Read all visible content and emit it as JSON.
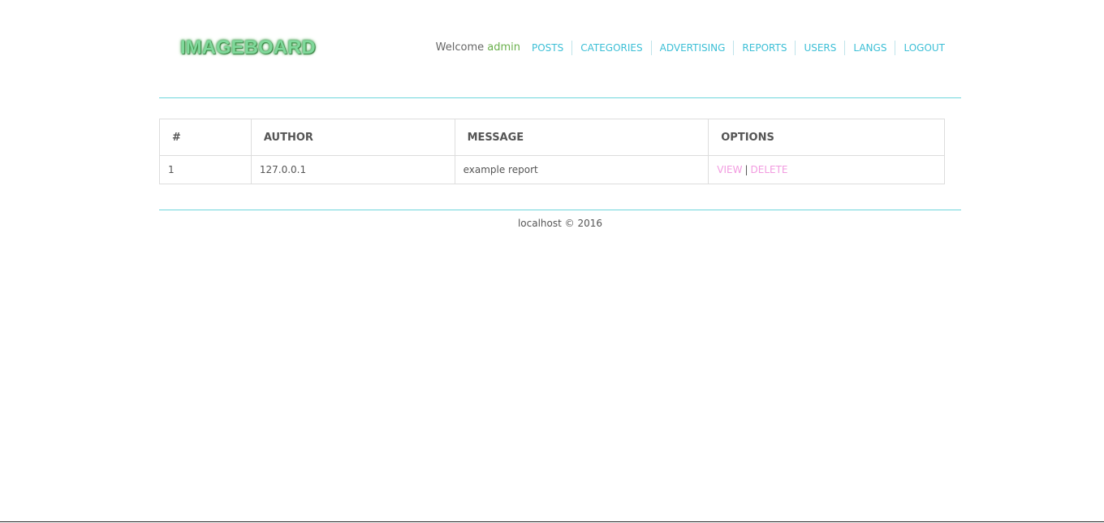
{
  "header": {
    "logo_text": "IMAGEBOARD",
    "welcome_prefix": "Welcome",
    "username": "admin",
    "nav": [
      {
        "label": "POSTS"
      },
      {
        "label": "CATEGORIES"
      },
      {
        "label": "ADVERTISING"
      },
      {
        "label": "REPORTS"
      },
      {
        "label": "USERS"
      },
      {
        "label": "LANGS"
      },
      {
        "label": "LOGOUT"
      }
    ]
  },
  "table": {
    "columns": [
      "#",
      "AUTHOR",
      "MESSAGE",
      "OPTIONS"
    ],
    "rows": [
      {
        "num": "1",
        "author": "127.0.0.1",
        "message": "example report",
        "view_label": "VIEW",
        "separator": "|",
        "delete_label": "DELETE"
      }
    ]
  },
  "footer": {
    "text": "localhost © 2016"
  },
  "colors": {
    "accent": "#3cbfd6",
    "rule": "#6ed6dc",
    "option_link": "#f29be0",
    "username": "#6ab04c",
    "logo": "#7fd89a"
  }
}
